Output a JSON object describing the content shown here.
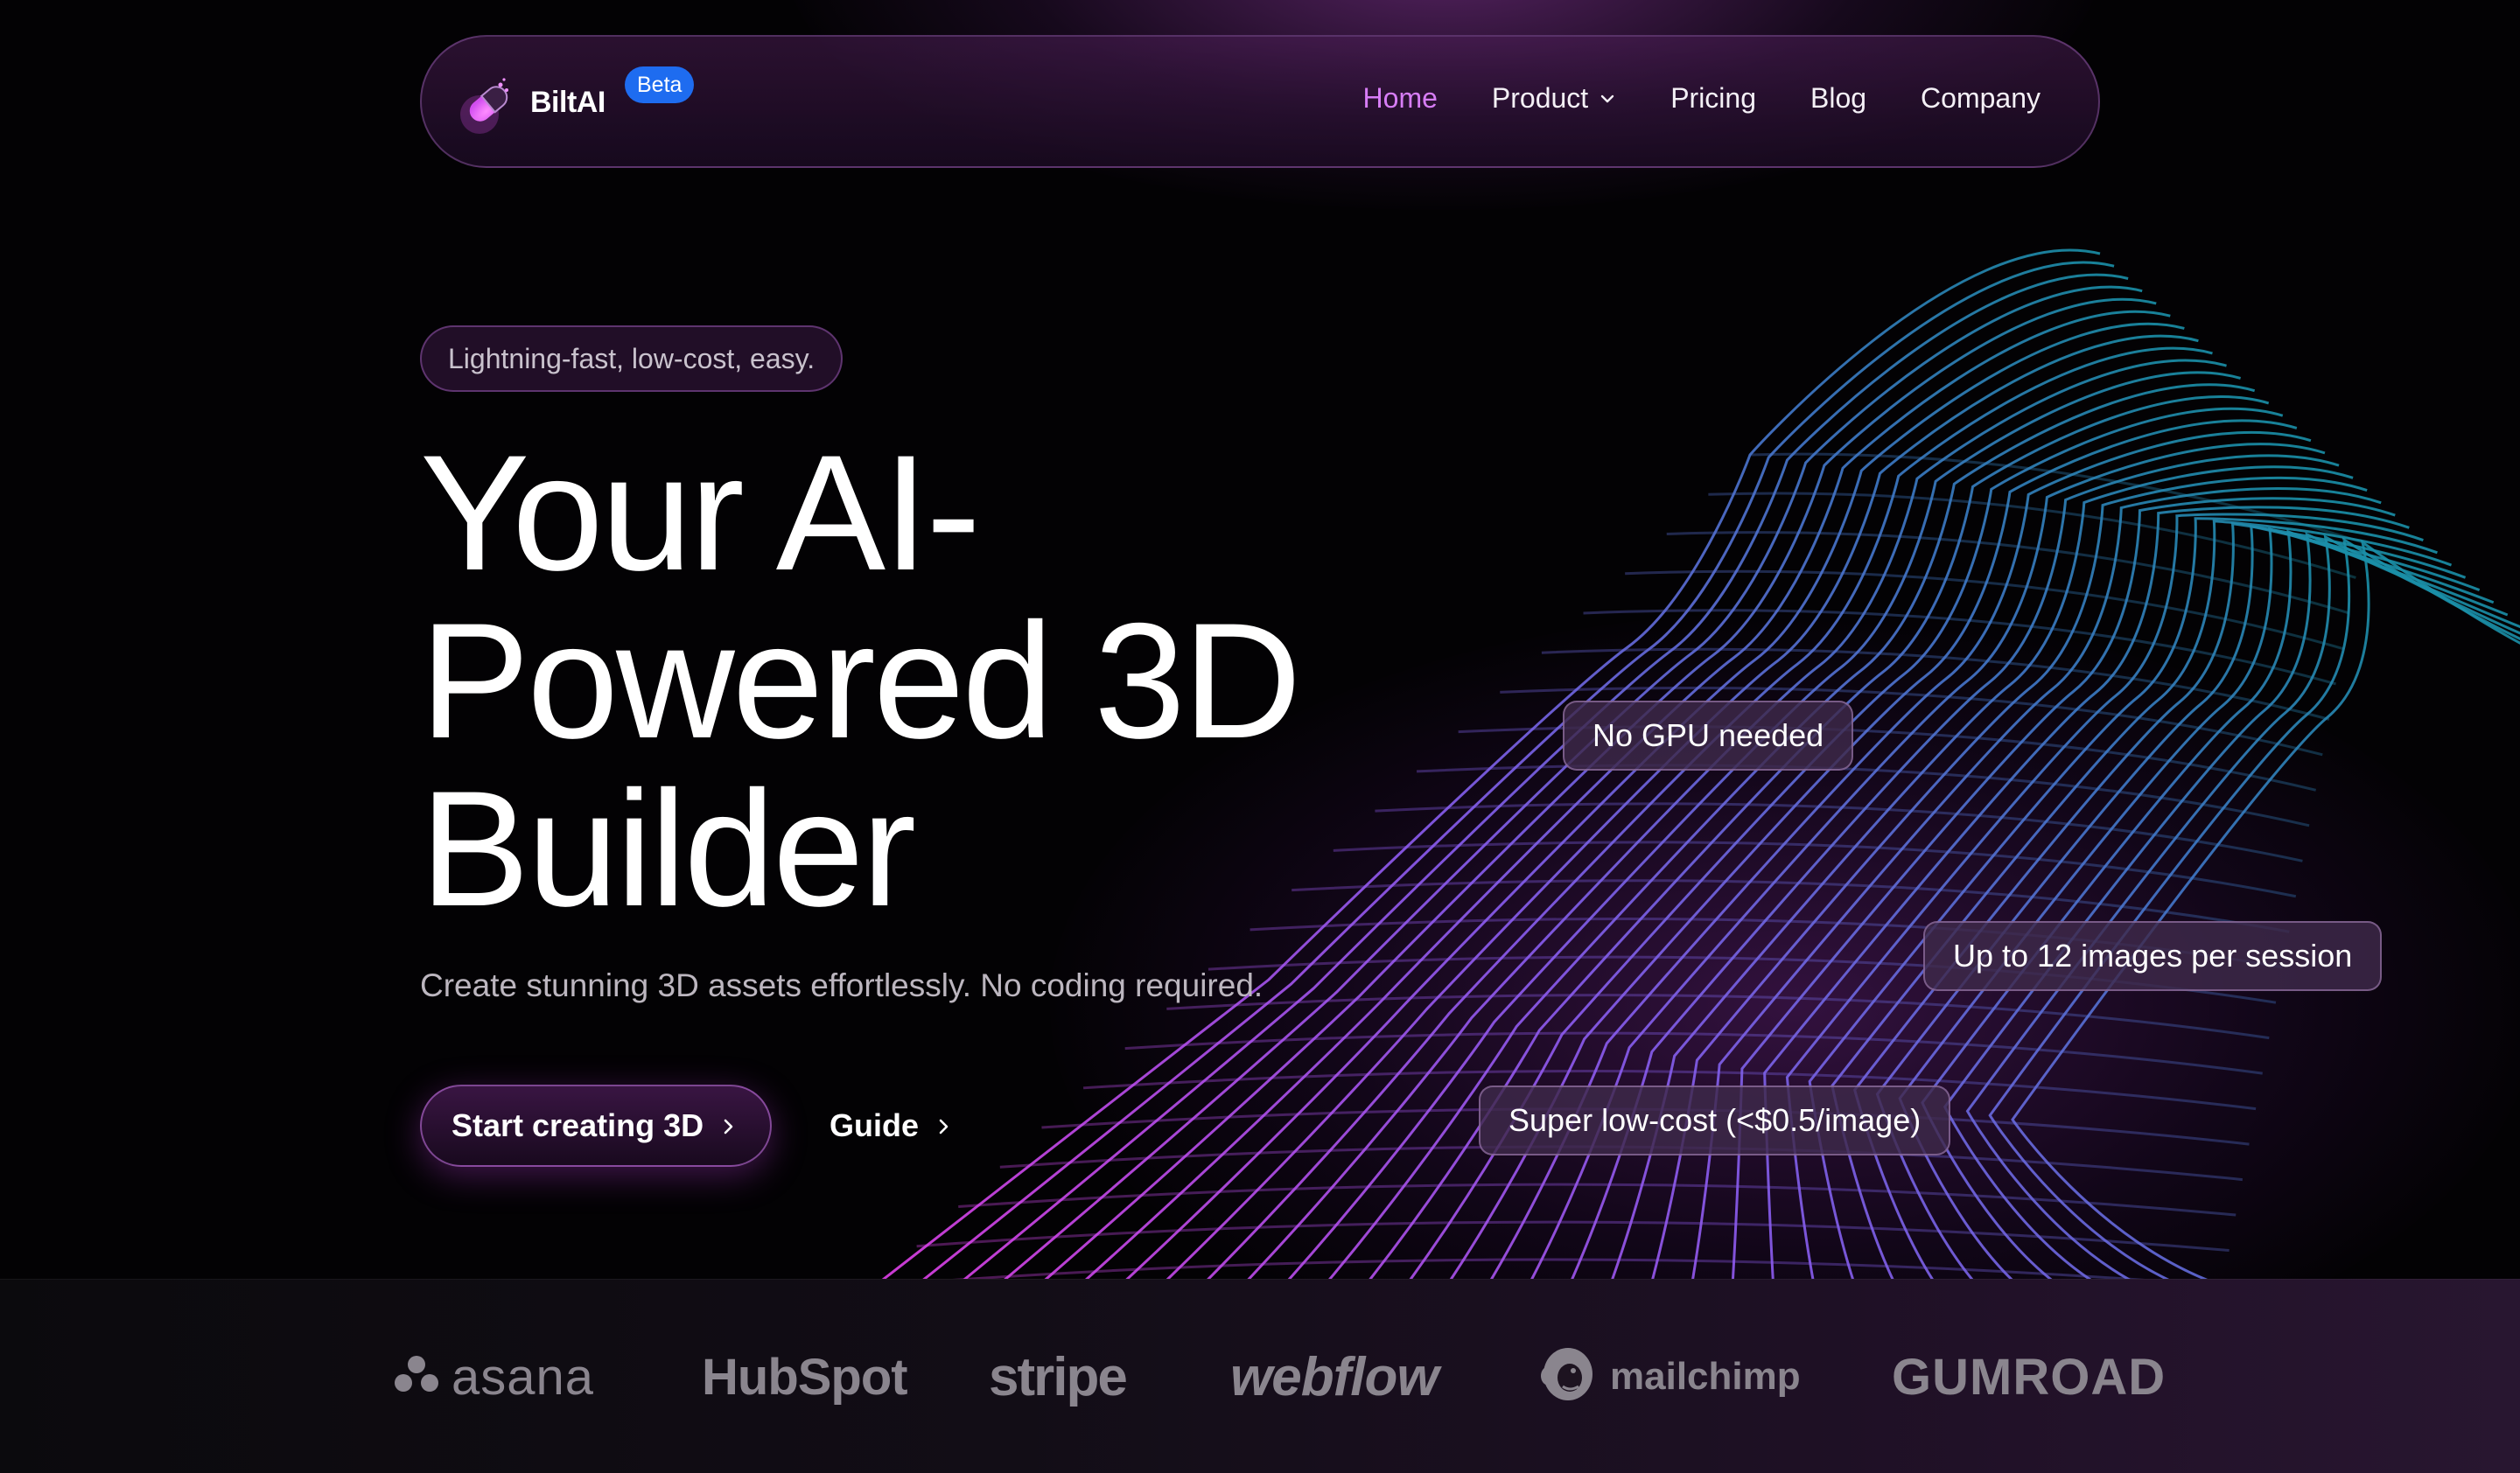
{
  "nav": {
    "brand": "BiltAI",
    "badge": "Beta",
    "links": [
      {
        "label": "Home",
        "active": true
      },
      {
        "label": "Product",
        "has_dropdown": true
      },
      {
        "label": "Pricing"
      },
      {
        "label": "Blog"
      },
      {
        "label": "Company"
      }
    ]
  },
  "hero": {
    "tagline": "Lightning-fast, low-cost, easy.",
    "headline": [
      "Your AI-",
      "Powered 3D",
      "Builder"
    ],
    "subtitle": "Create stunning 3D assets effortlessly. No coding required.",
    "cta_primary": "Start creating 3D",
    "cta_secondary": "Guide"
  },
  "features": [
    "No GPU needed",
    "Up to 12 images per session",
    "Super low-cost (<$0.5/image)"
  ],
  "partners": [
    "asana",
    "HubSpot",
    "stripe",
    "webflow",
    "mailchimp",
    "GUMROAD"
  ],
  "colors": {
    "accent": "#d77df6",
    "badge": "#1e6cf0",
    "background": "#030204",
    "mesh_start": "#e040e8",
    "mesh_mid": "#8a5cf0",
    "mesh_end": "#1a8fa8"
  },
  "icons": [
    "logo-capsule-icon",
    "chevron-down-icon",
    "chevron-right-icon",
    "asana-dots-icon",
    "mailchimp-icon"
  ]
}
